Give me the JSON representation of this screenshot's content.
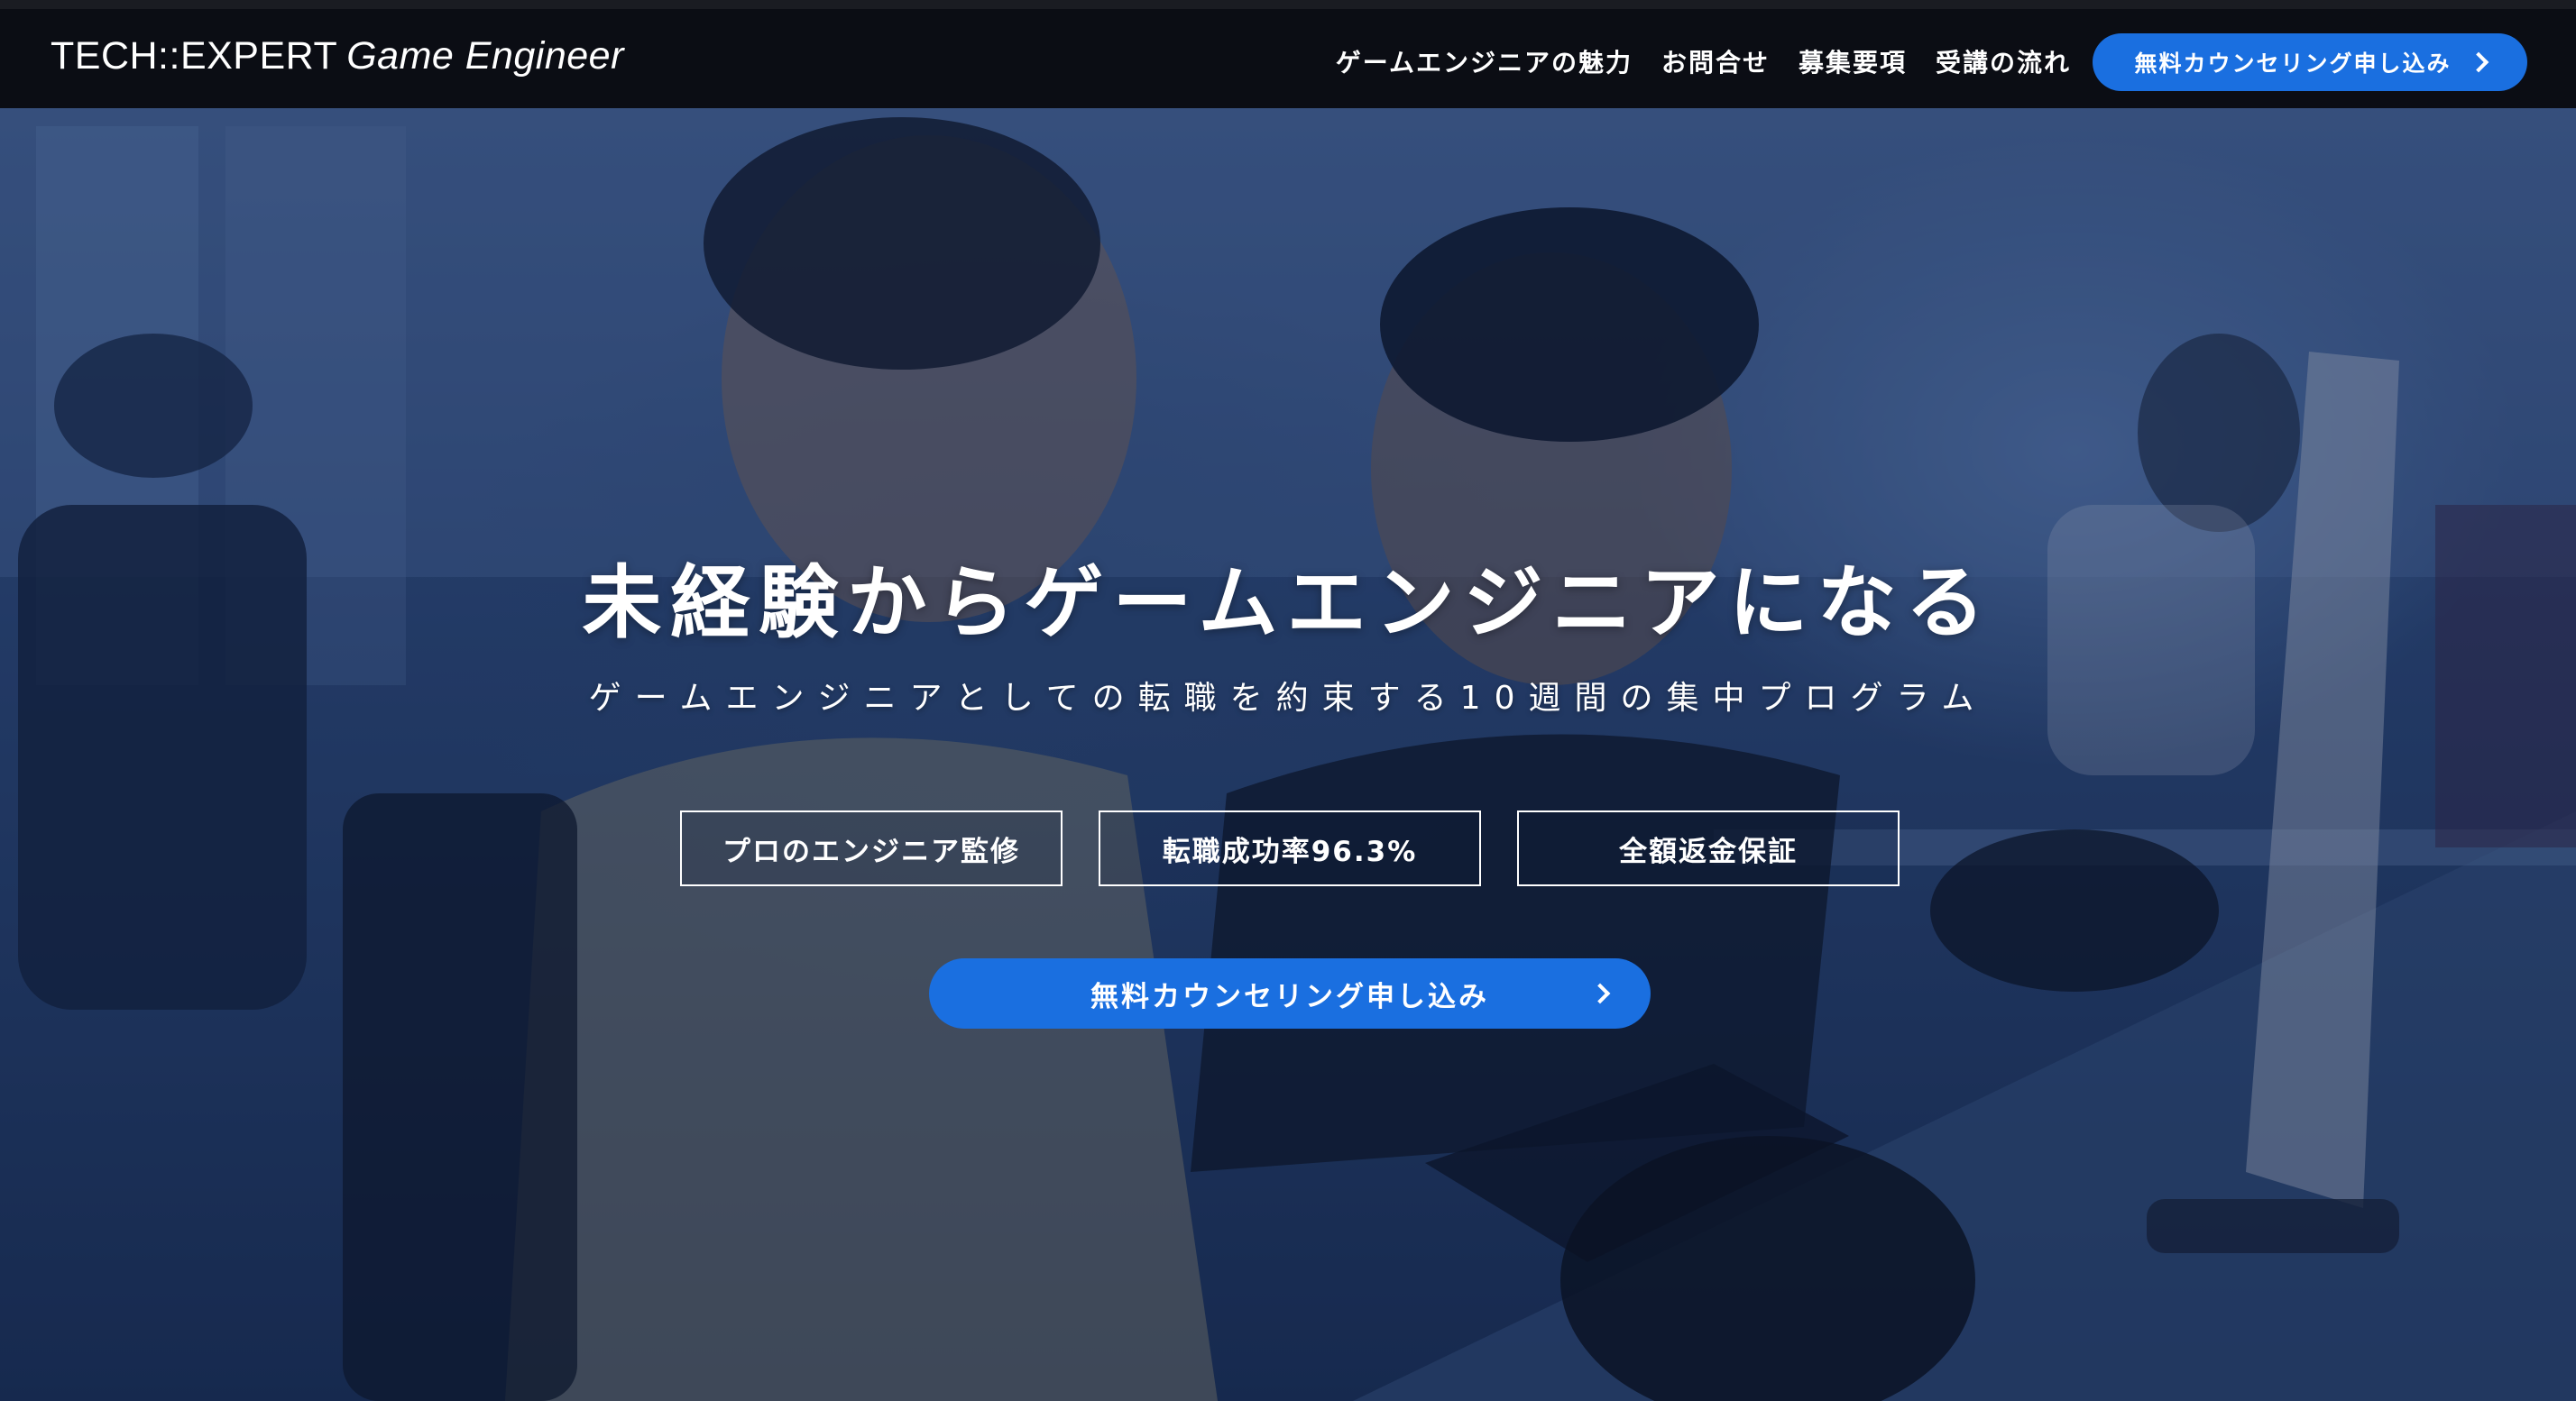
{
  "header": {
    "logo_brand": "TECH::EXPERT",
    "logo_sub": "Game Engineer",
    "nav": [
      "ゲームエンジニアの魅力",
      "お問合せ",
      "募集要項",
      "受講の流れ"
    ],
    "cta_label": "無料カウンセリング申し込み"
  },
  "hero": {
    "title": "未経験からゲームエンジニアになる",
    "subtitle": "ゲームエンジニアとしての転職を約束する10週間の集中プログラム",
    "badges": [
      "プロのエンジニア監修",
      "転職成功率96.3%",
      "全額返金保証"
    ],
    "cta_label": "無料カウンセリング申し込み"
  },
  "colors": {
    "accent": "#1a6fe0",
    "header_bg": "#0b0d14",
    "hero_tint": "#2f4a7a"
  },
  "icons": {
    "cta_arrow": "chevron-right-icon"
  }
}
